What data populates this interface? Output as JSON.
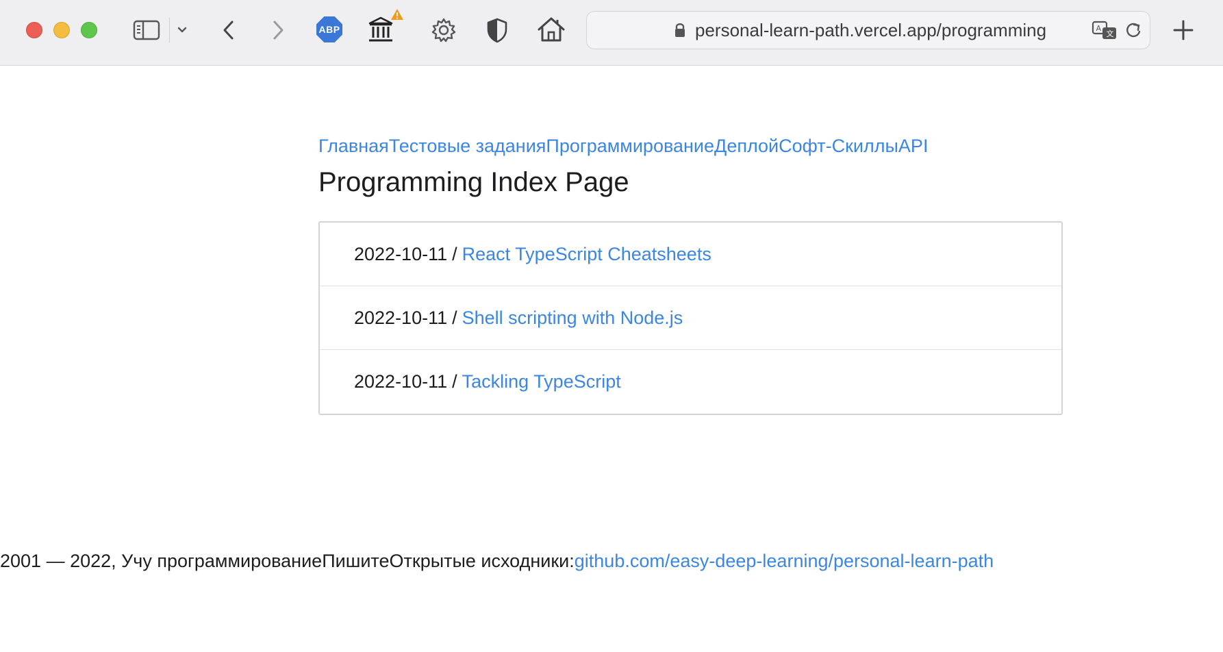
{
  "browser": {
    "address_url": "personal-learn-path.vercel.app/programming",
    "abp_label": "ABP",
    "icons": [
      "sidebar-icon",
      "chevron-down-icon",
      "back-icon",
      "forward-icon",
      "abp-icon",
      "museum-icon",
      "warning-icon",
      "gear-icon",
      "shield-icon",
      "home-icon",
      "lock-icon",
      "translate-icon",
      "reload-icon",
      "new-tab-icon"
    ]
  },
  "nav": {
    "items": [
      {
        "label": "Главная"
      },
      {
        "label": "Тестовые задания"
      },
      {
        "label": "Программирование"
      },
      {
        "label": "Деплой"
      },
      {
        "label": "Софт-Скиллы"
      },
      {
        "label": "API"
      }
    ]
  },
  "page": {
    "title": "Programming Index Page"
  },
  "posts": [
    {
      "date": "2022-10-11",
      "separator": "/",
      "title": "React TypeScript Cheatsheets"
    },
    {
      "date": "2022-10-11",
      "separator": "/",
      "title": "Shell scripting with Node.js"
    },
    {
      "date": "2022-10-11",
      "separator": "/",
      "title": "Tackling TypeScript"
    }
  ],
  "footer": {
    "copyright": "2001 — 2022, Учу программирование",
    "write": "Пишите",
    "open_source": "Открытые исходники:",
    "repo_link": "github.com/easy-deep-learning/personal-learn-path"
  },
  "colors": {
    "link": "#3b86e1",
    "text": "#1d1d1f",
    "toolbar": "#efeff1"
  }
}
